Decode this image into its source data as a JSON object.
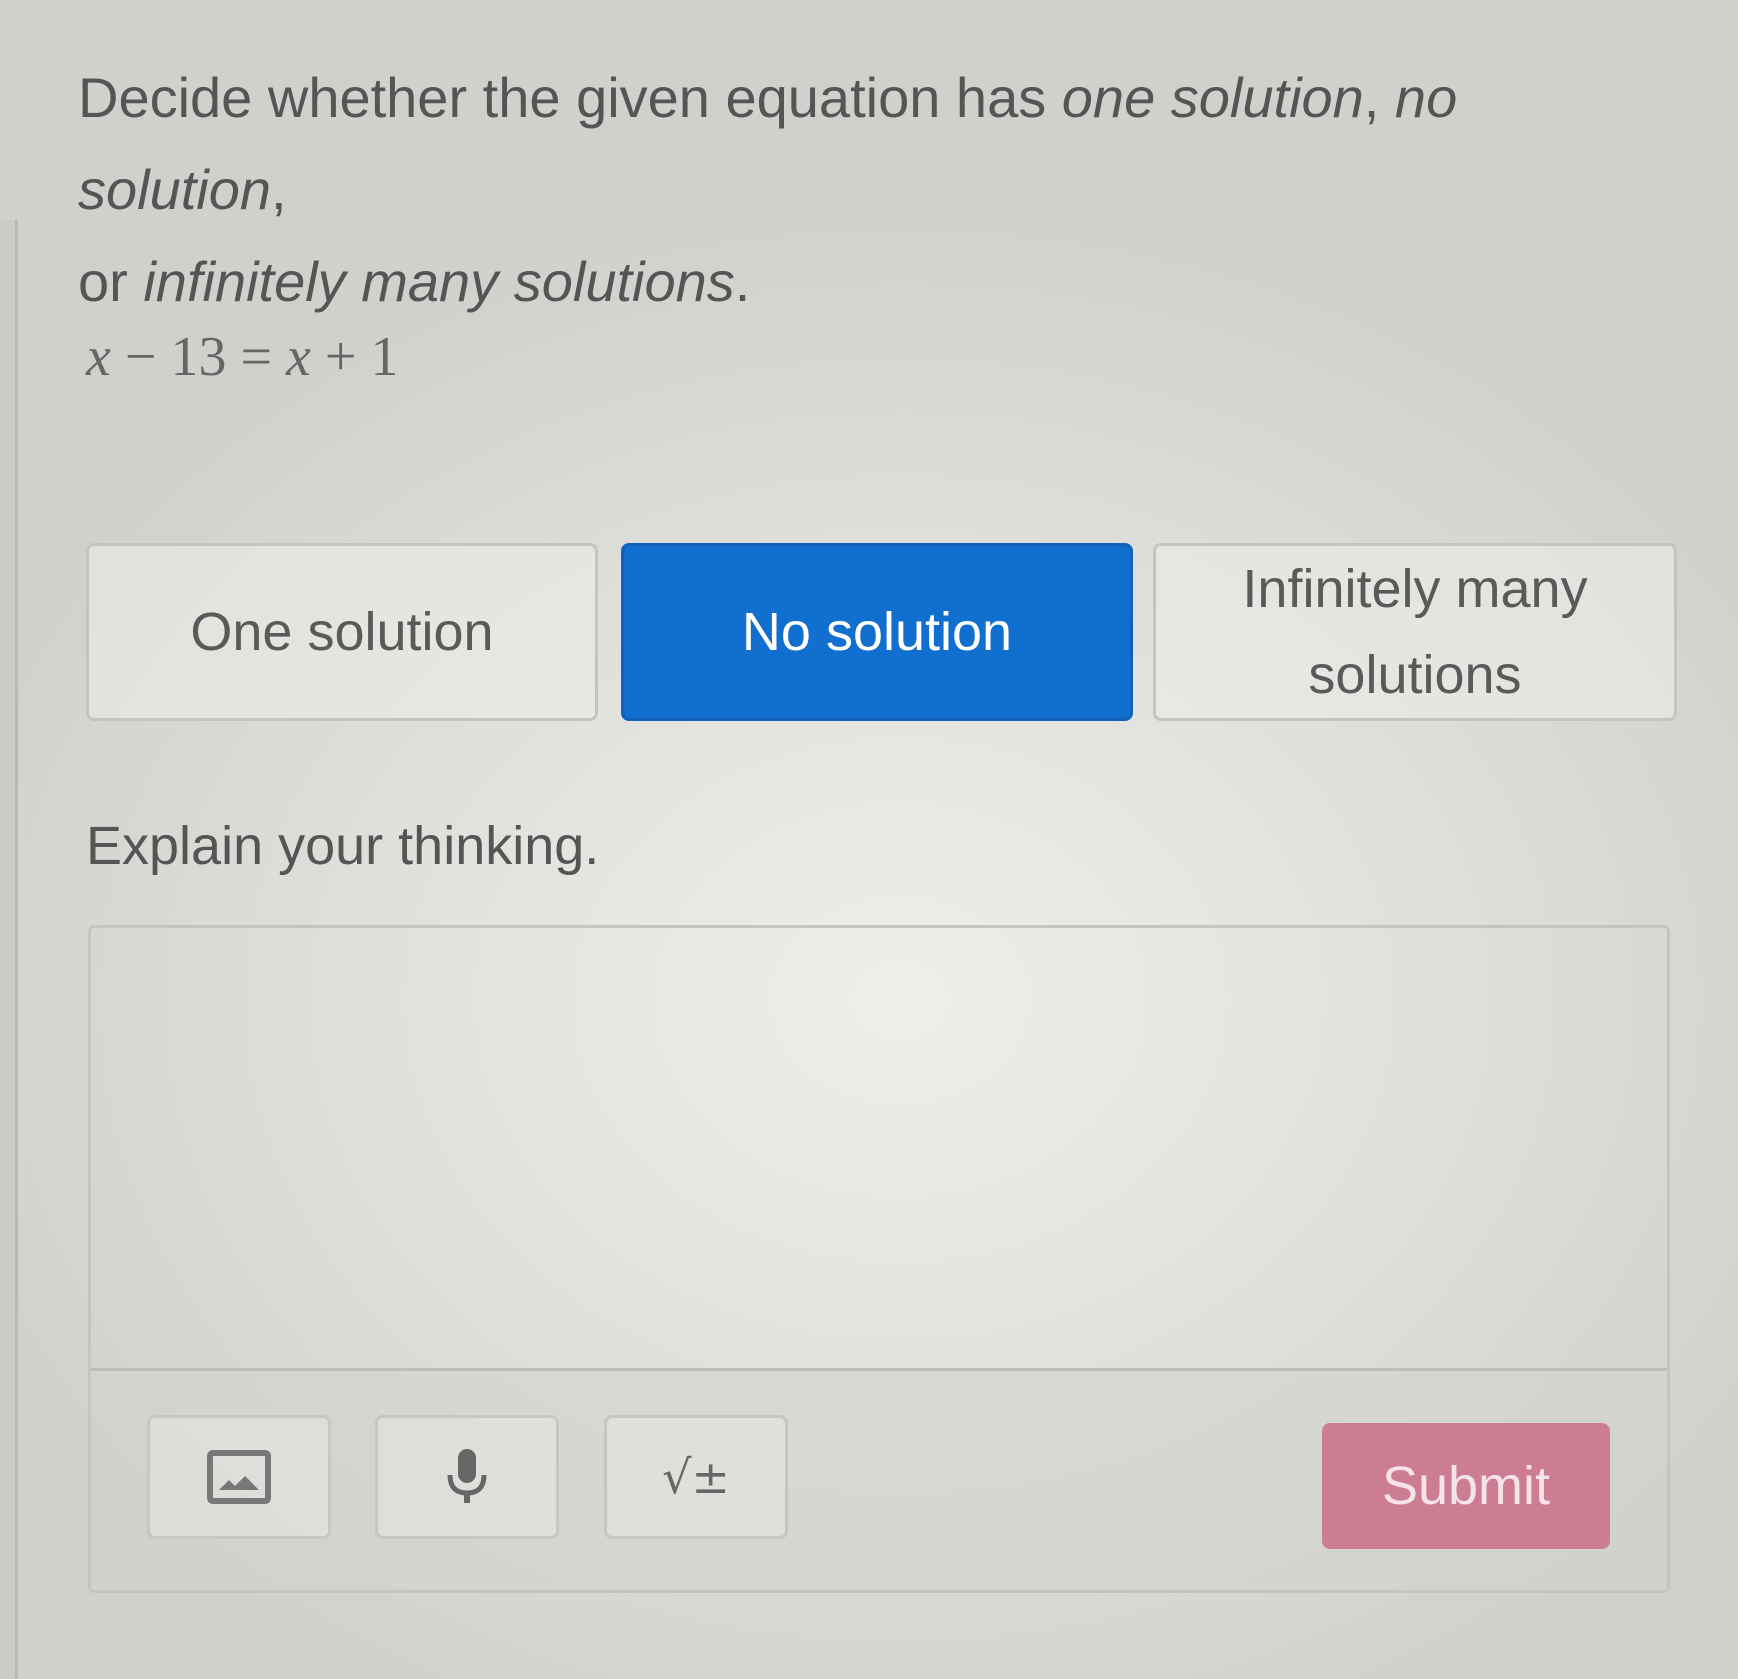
{
  "prompt": {
    "part1": "Decide whether the given equation has ",
    "em1": "one solution",
    "sep1": ", ",
    "em2": "no solution",
    "sep2": ",",
    "part2": "or ",
    "em3": "infinitely many solutions",
    "end": "."
  },
  "equation": {
    "lhs_var": "x",
    "lhs_rest": " − 13 = ",
    "rhs_var": "x",
    "rhs_rest": " + 1"
  },
  "choices": {
    "one": "One solution",
    "no": "No solution",
    "inf_line1": "Infinitely many",
    "inf_line2": "solutions",
    "selected": "No solution"
  },
  "explain": {
    "label": "Explain your thinking.",
    "value": ""
  },
  "toolbar": {
    "icons": [
      "image-icon",
      "microphone-icon",
      "math-equation-icon"
    ],
    "math_glyph": "√±",
    "submit_label": "Submit"
  },
  "colors": {
    "selected_choice": "#116fd0",
    "submit": "#cc7d93"
  }
}
